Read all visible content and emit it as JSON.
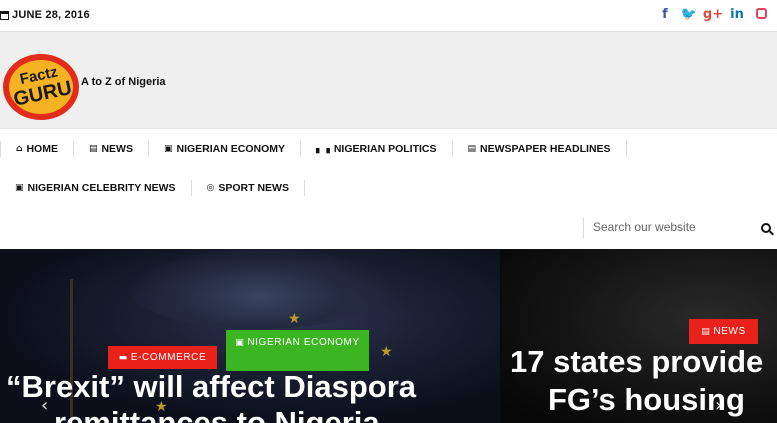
{
  "topbar": {
    "date": "JUNE 28, 2016",
    "social": [
      {
        "name": "facebook-icon",
        "glyph": "f"
      },
      {
        "name": "twitter-icon",
        "glyph": "🐦"
      },
      {
        "name": "google-plus-icon",
        "glyph": "g+"
      },
      {
        "name": "linkedin-icon",
        "glyph": "in"
      },
      {
        "name": "instagram-icon",
        "glyph": ""
      }
    ]
  },
  "header": {
    "logo_text_top": "Factz",
    "logo_text_bottom": "GURU",
    "tagline": "A to Z of Nigeria"
  },
  "nav": {
    "items": [
      {
        "label": "HOME",
        "icon": "home-icon"
      },
      {
        "label": "NEWS",
        "icon": "newspaper-icon"
      },
      {
        "label": "NIGERIAN ECONOMY",
        "icon": "money-icon"
      },
      {
        "label": "NIGERIAN POLITICS",
        "icon": "institution-icon"
      },
      {
        "label": "NEWSPAPER HEADLINES",
        "icon": "newspaper-icon"
      },
      {
        "label": "NIGERIAN CELEBRITY NEWS",
        "icon": "camera-icon"
      },
      {
        "label": "SPORT NEWS",
        "icon": "soccer-ball-icon"
      }
    ],
    "search_placeholder": "Search our website"
  },
  "slider": {
    "slide1": {
      "tags": [
        "E-COMMERCE",
        "NIGERIAN ECONOMY"
      ],
      "headline_line1": "“Brexit” will affect Diaspora",
      "headline_line2": "remittances to Nigeria"
    },
    "slide2": {
      "tag": "NEWS",
      "headline_line1": "17 states provide",
      "headline_line2": "FG’s housing"
    }
  },
  "colors": {
    "accent_red": "#e8211a",
    "accent_green": "#3cb523"
  }
}
